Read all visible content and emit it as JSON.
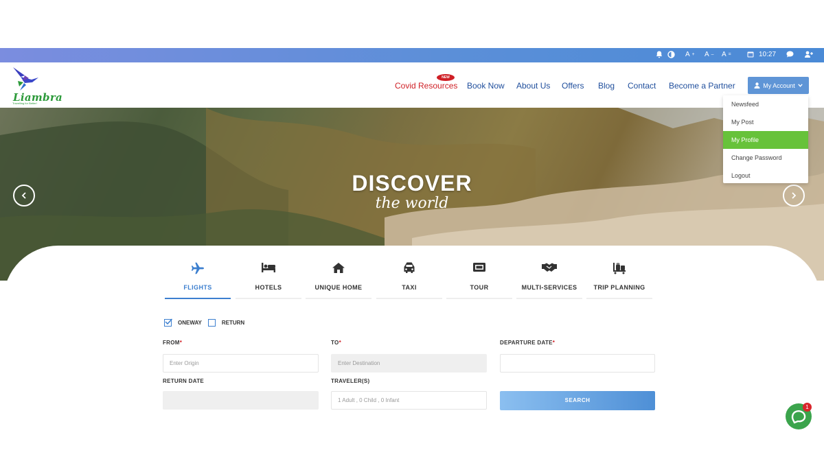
{
  "utility": {
    "font_small": "A",
    "font_small_mark": "+",
    "font_reset": "A",
    "font_reset_mark": "–",
    "font_large": "A",
    "font_large_mark": "=",
    "time": "10:27"
  },
  "brand": {
    "logo_text": "Liambra",
    "tagline": "Travelling for Better!",
    "accent": "#5f95d6",
    "nav_text_color": "#1f4e9c",
    "covid_color": "#cf1f25"
  },
  "nav": {
    "new_badge": "NEW",
    "covid": "Covid Resources",
    "book_now": "Book Now",
    "about_us": "About Us",
    "offers": "Offers",
    "blog": "Blog",
    "contact": "Contact",
    "partner": "Become a Partner",
    "account": "My Account"
  },
  "account_menu": {
    "items": [
      "Newsfeed",
      "My Post",
      "My Profile",
      "Change Password",
      "Logout"
    ],
    "active": "My Profile"
  },
  "hero": {
    "title": "DISCOVER",
    "subtitle": "the world"
  },
  "tabs": {
    "active": "FLIGHTS",
    "labels": [
      "FLIGHTS",
      "HOTELS",
      "UNIQUE HOME",
      "TAXI",
      "TOUR",
      "MULTI-SERVICES",
      "TRIP PLANNING"
    ],
    "icons": [
      "plane-icon",
      "bed-icon",
      "home-icon",
      "taxi-icon",
      "ticket-icon",
      "handshake-icon",
      "luggage-icon"
    ]
  },
  "trip_type": {
    "oneway": "ONEWAY",
    "oneway_checked": true,
    "return": "RETURN",
    "return_checked": false
  },
  "form": {
    "from_label": "FROM",
    "to_label": "TO",
    "departure_label": "DEPARTURE DATE",
    "required_mark": "*",
    "from_placeholder": "Enter Origin",
    "to_placeholder": "Enter Destination",
    "departure_value": "",
    "return_label": "RETURN DATE",
    "return_value": "",
    "travelers_label": "TRAVELER(S)",
    "travelers_value": "1 Adult , 0 Child , 0 Infant",
    "search_label": "SEARCH"
  },
  "chat": {
    "badge_count": "1"
  }
}
